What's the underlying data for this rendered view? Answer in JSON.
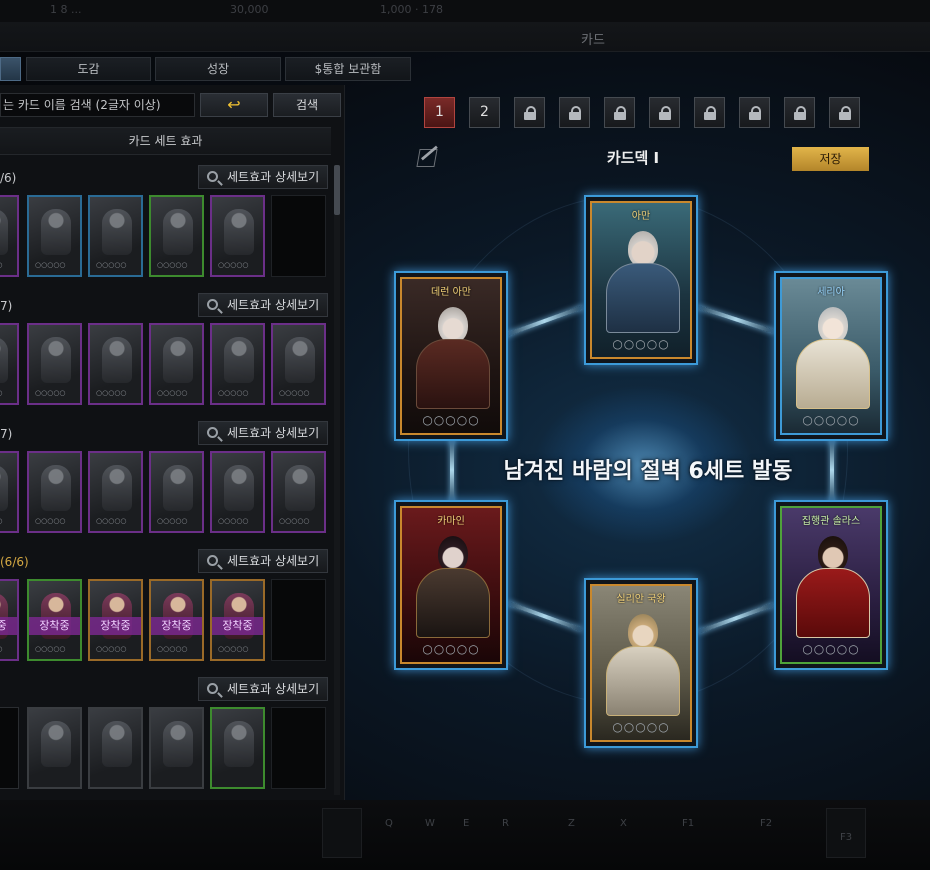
{
  "window": {
    "title": "카드"
  },
  "top_bar": {
    "ghost_left": "1 8 ...",
    "ghost_mid": "30,000",
    "ghost_right": "1,000 · 178"
  },
  "tabs": [
    {
      "label": ""
    },
    {
      "label": "도감"
    },
    {
      "label": "성장"
    },
    {
      "label": "$통합 보관함"
    }
  ],
  "search": {
    "placeholder": "는 카드 이름 검색 (2글자 이상)",
    "refresh_icon": "↩",
    "search_label": "검색"
  },
  "set_effect_header": "카드 세트 효과",
  "detail_label": "세트효과 상세보기",
  "sets": [
    {
      "name": "/6)",
      "gold": false
    },
    {
      "name": "7)",
      "gold": false
    },
    {
      "name": "7)",
      "gold": false
    },
    {
      "name": "(6/6)",
      "gold": true
    },
    {
      "name": "",
      "gold": false
    }
  ],
  "equipped_badge": "장착중",
  "pips": "○○○○○",
  "deck": {
    "slots": [
      "1",
      "2"
    ],
    "locked_count": 8,
    "name": "카드덱 I",
    "save_label": "저장",
    "banner": "남겨진 바람의 절벽 6세트 발동",
    "cards": [
      {
        "name": "아만",
        "rarity": "orange"
      },
      {
        "name": "데런 아만",
        "rarity": "orange"
      },
      {
        "name": "세리아",
        "rarity": "blue"
      },
      {
        "name": "카마인",
        "rarity": "orange"
      },
      {
        "name": "집행관 솔라스",
        "rarity": "green"
      },
      {
        "name": "실리안 국왕",
        "rarity": "orange"
      }
    ]
  },
  "hotbar": {
    "keys": [
      "Q",
      "W",
      "E",
      "R",
      "Z",
      "X",
      "F1",
      "F2",
      "F3"
    ]
  }
}
